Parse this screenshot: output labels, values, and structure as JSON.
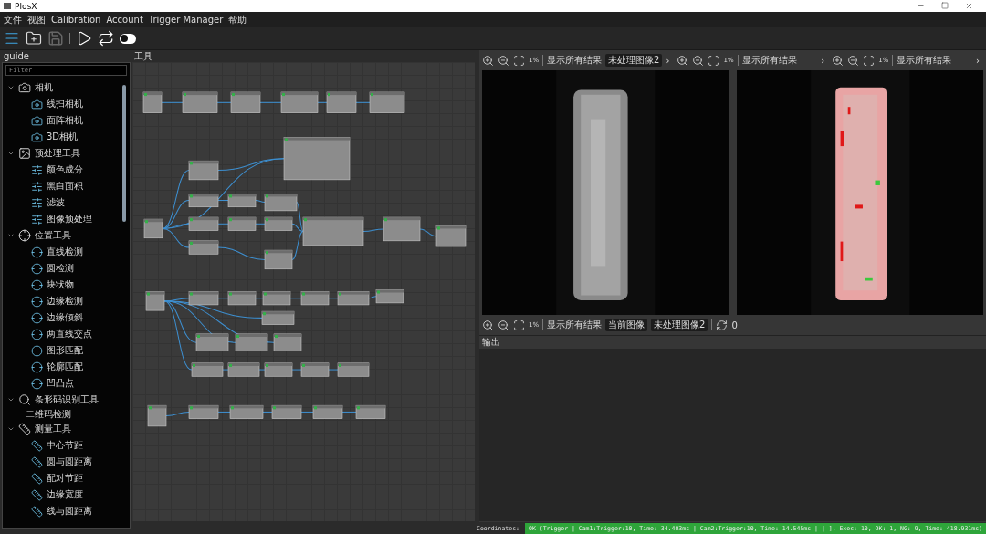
{
  "window": {
    "title": "PlqsX"
  },
  "menu": [
    {
      "label": "文件"
    },
    {
      "label": "视图"
    },
    {
      "label": "Calibration"
    },
    {
      "label": "Account"
    },
    {
      "label": "Trigger Manager"
    },
    {
      "label": "帮助"
    }
  ],
  "toolbar": {
    "save_disabled": true,
    "toggle_on": false
  },
  "guide": {
    "title": "guide",
    "filter": {
      "placeholder": "Filter"
    },
    "tree": [
      {
        "label": "相机",
        "expanded": true,
        "children": [
          {
            "label": "线扫相机",
            "kind": "tool"
          },
          {
            "label": "面阵相机",
            "kind": "tool"
          },
          {
            "label": "3D相机",
            "kind": "tool"
          }
        ]
      },
      {
        "label": "预处理工具",
        "expanded": true,
        "children": [
          {
            "label": "颜色成分",
            "kind": "tool"
          },
          {
            "label": "黑白面积",
            "kind": "tool"
          },
          {
            "label": "滤波",
            "kind": "tool"
          },
          {
            "label": "图像预处理",
            "kind": "tool"
          }
        ]
      },
      {
        "label": "位置工具",
        "expanded": true,
        "children": [
          {
            "label": "直线检测",
            "kind": "tool"
          },
          {
            "label": "圆检测",
            "kind": "tool"
          },
          {
            "label": "块状物",
            "kind": "tool"
          },
          {
            "label": "边缘检测",
            "kind": "tool"
          },
          {
            "label": "边缘倾斜",
            "kind": "tool"
          },
          {
            "label": "两直线交点",
            "kind": "tool"
          },
          {
            "label": "图形匹配",
            "kind": "tool"
          },
          {
            "label": "轮廓匹配",
            "kind": "tool"
          },
          {
            "label": "凹凸点",
            "kind": "tool"
          }
        ]
      },
      {
        "label": "条形码识别工具",
        "expanded": true,
        "children": [
          {
            "label": "二维码检测",
            "kind": "text"
          }
        ]
      },
      {
        "label": "测量工具",
        "expanded": true,
        "children": [
          {
            "label": "中心节距",
            "kind": "tool"
          },
          {
            "label": "圆与圆距离",
            "kind": "tool"
          },
          {
            "label": "配对节距",
            "kind": "tool"
          },
          {
            "label": "边缘宽度",
            "kind": "tool"
          },
          {
            "label": "线与圆距离",
            "kind": "tool"
          }
        ]
      }
    ]
  },
  "canvas": {
    "title": "工具"
  },
  "viewer_toolbar": [
    {
      "zoom": "1%",
      "show_all": "显示所有结果",
      "dropdowns": [
        "未处理图像2"
      ],
      "arrow": "›"
    },
    {
      "zoom": "1%",
      "show_all": "显示所有结果",
      "arrow": "›"
    },
    {
      "zoom": "1%",
      "show_all": "显示所有结果",
      "arrow": "›"
    }
  ],
  "lower_toolbar": {
    "zoom": "1%",
    "show_all": "显示所有结果",
    "dropdowns": [
      "当前图像",
      "未处理图像2"
    ],
    "count": "0"
  },
  "output": {
    "title": "输出"
  },
  "status_bar": {
    "label": "Coordinates:",
    "text": "OK (Trigger  | Cam1:Trigger:10, Time: 34.403ms | Cam2:Trigger:10, Time: 14.545ms |  | ], Exec: 10, OK: 1, NG: 9, Time: 418.931ms)"
  }
}
